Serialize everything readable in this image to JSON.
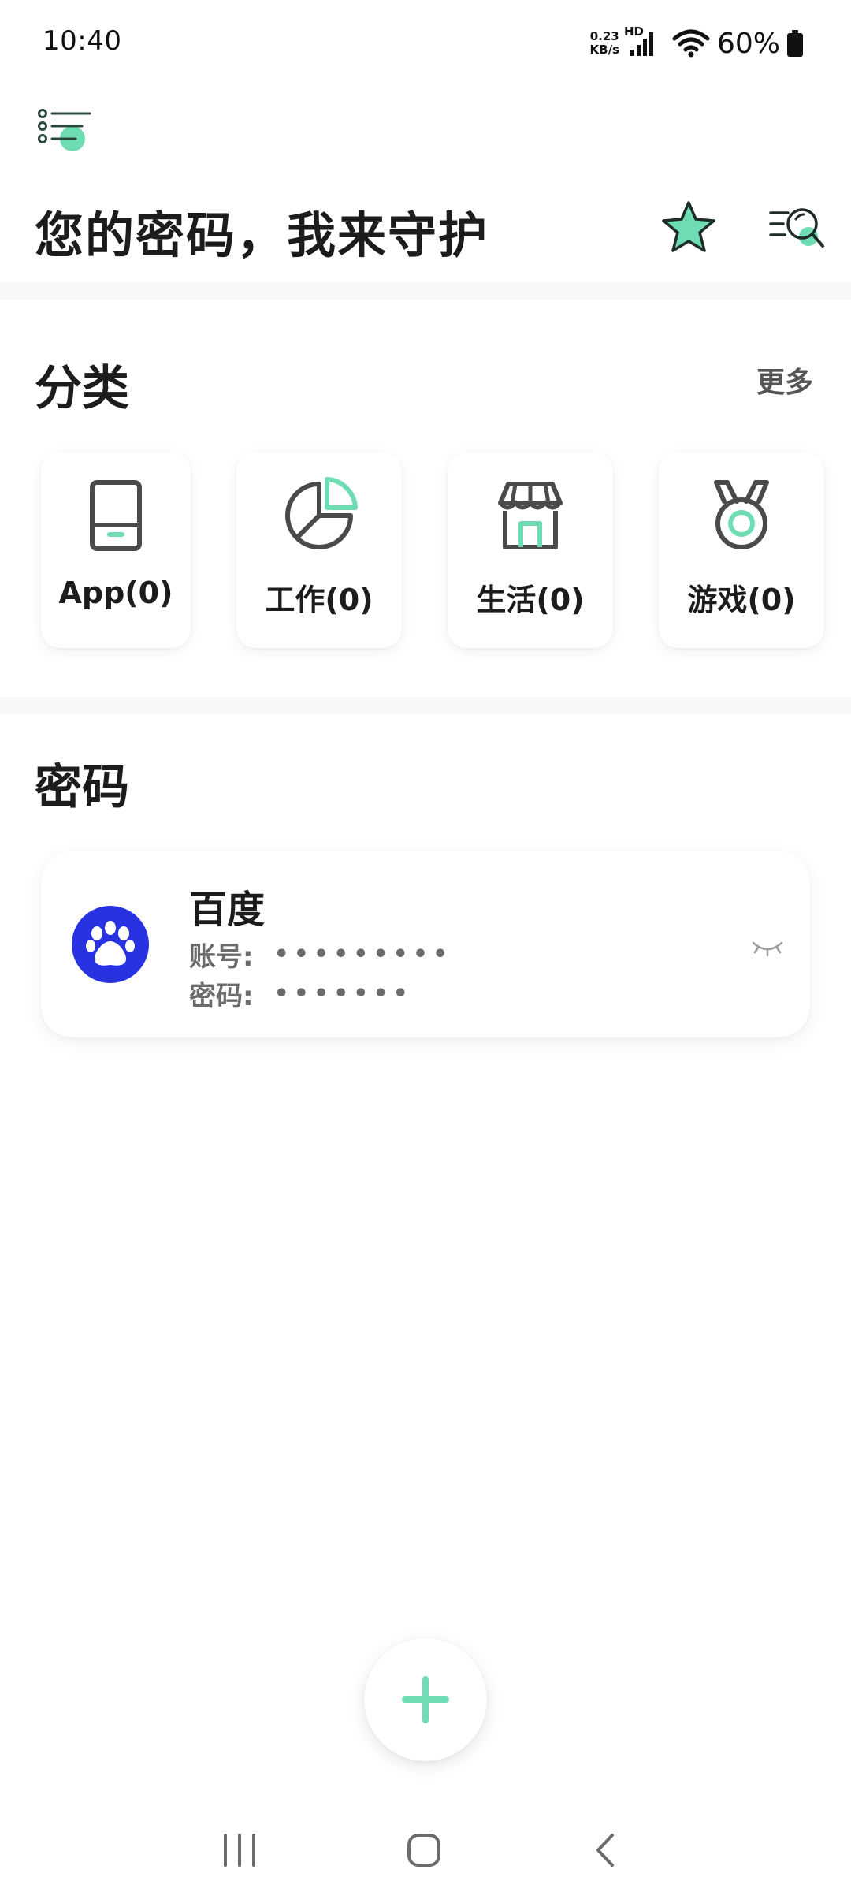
{
  "status_bar": {
    "time": "10:40",
    "net_speed_value": "0.23",
    "net_speed_unit": "KB/s",
    "network_type": "HD",
    "battery": "60%"
  },
  "header": {
    "title": "您的密码，我来守护",
    "menu_icon": "menu-list-icon",
    "favorites_icon": "star-icon",
    "search_icon": "list-search-icon"
  },
  "categories": {
    "title": "分类",
    "more_label": "更多",
    "items": [
      {
        "label": "App(0)",
        "icon": "tablet-icon"
      },
      {
        "label": "工作(0)",
        "icon": "pie-chart-icon"
      },
      {
        "label": "生活(0)",
        "icon": "store-icon"
      },
      {
        "label": "游戏(0)",
        "icon": "medal-icon"
      }
    ]
  },
  "passwords": {
    "title": "密码",
    "items": [
      {
        "name": "百度",
        "icon": "baidu-paw-icon",
        "account_label": "账号:",
        "account_masked": "•••••••••",
        "password_label": "密码:",
        "password_masked": "•••••••"
      }
    ]
  },
  "colors": {
    "accent": "#6fdcb3",
    "dark_icon": "#4a4a4a",
    "baidu_blue": "#2932e1",
    "divider": "#f6f7f8"
  },
  "fab": {
    "icon": "plus-icon"
  },
  "nav": {
    "recents_icon": "recents-icon",
    "home_icon": "home-icon",
    "back_icon": "back-icon"
  }
}
